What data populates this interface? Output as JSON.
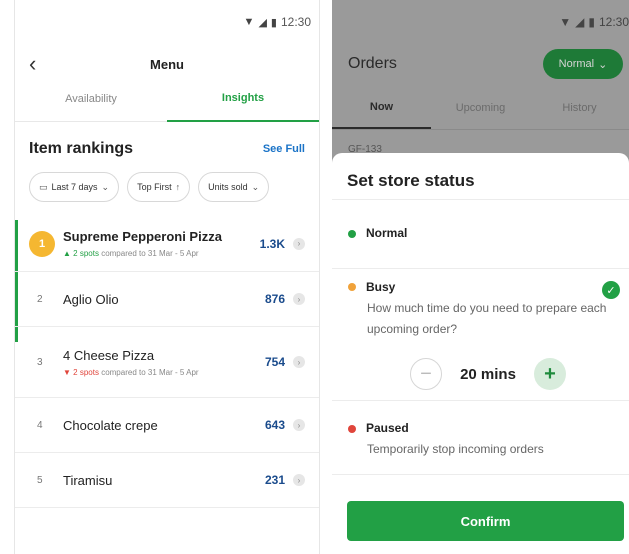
{
  "left_phone": {
    "time": "12:30",
    "title": "Menu",
    "back_symbol": "‹",
    "tabs": [
      {
        "label": "Availability"
      },
      {
        "label": "Insights"
      }
    ],
    "section_title": "Item rankings",
    "see_full": "See Full",
    "filters": [
      {
        "icon": "calendar-icon",
        "glyph": "▭",
        "label": "Last 7 days",
        "suffix": "⌄"
      },
      {
        "icon": "arrow-up-icon",
        "glyph": "",
        "label": "Top First",
        "suffix": "↑"
      },
      {
        "icon": "chevron-down-icon",
        "glyph": "",
        "label": "Units sold",
        "suffix": "⌄"
      }
    ],
    "rankings": [
      {
        "rank": "1",
        "name": "Supreme Pepperoni Pizza",
        "value": "1.3K",
        "delta": {
          "direction": "up",
          "arrow": "▲",
          "spots": "2 spots",
          "text": "compared to 31 Mar - 5 Apr"
        }
      },
      {
        "rank": "2",
        "name": "Aglio Olio",
        "value": "876"
      },
      {
        "rank": "3",
        "name": "4 Cheese Pizza",
        "value": "754",
        "delta": {
          "direction": "down",
          "arrow": "▼",
          "spots": "2 spots",
          "text": "compared to 31 Mar - 5 Apr"
        }
      },
      {
        "rank": "4",
        "name": "Chocolate crepe",
        "value": "643"
      },
      {
        "rank": "5",
        "name": "Tiramisu",
        "value": "231"
      }
    ]
  },
  "right_phone": {
    "time": "12:30",
    "title": "Orders",
    "status_pill": "Normal",
    "tabs": [
      {
        "label": "Now"
      },
      {
        "label": "Upcoming"
      },
      {
        "label": "History"
      }
    ],
    "order_id": "GF-133",
    "sheet": {
      "title": "Set store status",
      "options": [
        {
          "label": "Normal",
          "color": "#22a045"
        },
        {
          "label": "Busy",
          "color": "#f0a23a",
          "description": "How much time do you need to prepare each upcoming order?",
          "selected": true
        },
        {
          "label": "Paused",
          "color": "#e0453b",
          "description": "Temporarily stop incoming orders"
        }
      ],
      "stepper": {
        "minus": "−",
        "plus": "+",
        "value": "20 mins"
      },
      "confirm": "Confirm"
    }
  },
  "colors": {
    "accent": "#22a045",
    "link": "#1a73c7",
    "value": "#1a4b8c",
    "gold": "#f5b731"
  }
}
